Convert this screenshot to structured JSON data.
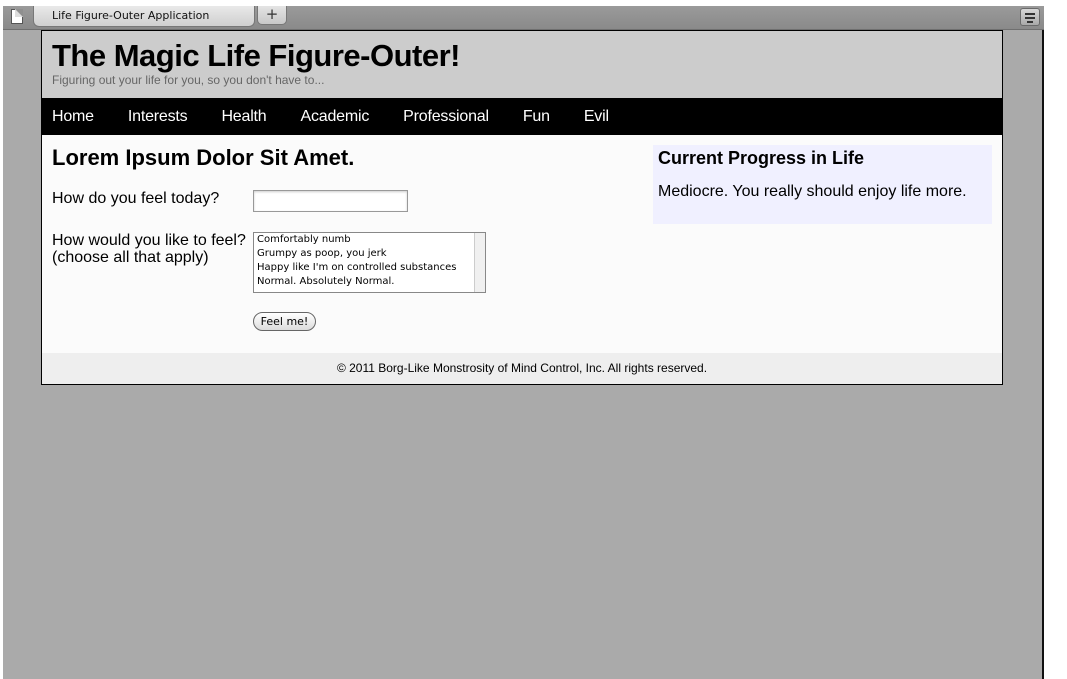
{
  "browser": {
    "tab_title": "Life Figure-Outer Application",
    "new_tab_label": "+"
  },
  "site": {
    "title": "The Magic Life Figure-Outer!",
    "tagline": "Figuring out your life for you, so you don't have to..."
  },
  "nav": {
    "items": [
      "Home",
      "Interests",
      "Health",
      "Academic",
      "Professional",
      "Fun",
      "Evil"
    ]
  },
  "main": {
    "heading": "Lorem Ipsum Dolor Sit Amet.",
    "feel_today_label": "How do you feel today?",
    "feel_today_value": "",
    "like_to_feel_label_1": "How would you like to feel?",
    "like_to_feel_label_2": "(choose all that apply)",
    "like_to_feel_options": [
      "Comfortably numb",
      "Grumpy as poop, you jerk",
      "Happy like I'm on controlled substances",
      "Normal. Absolutely Normal."
    ],
    "submit_label": "Feel me!"
  },
  "sidebar": {
    "title": "Current Progress in Life",
    "text": "Mediocre. You really should enjoy life more."
  },
  "footer": {
    "text": "© 2011 Borg-Like Monstrosity of Mind Control, Inc. All rights reserved."
  },
  "icons": {
    "tab": "document-icon",
    "tab_list": "tab-list-icon"
  },
  "colors": {
    "header_bg": "#cccccc",
    "nav_bg": "#000000",
    "sidebar_bg": "#f0f0ff",
    "browser_bg": "#aaaaaa"
  }
}
